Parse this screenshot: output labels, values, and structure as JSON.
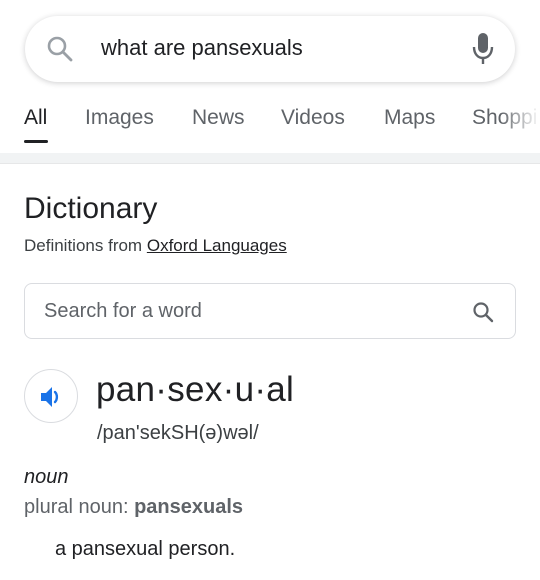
{
  "search": {
    "query": "what are pansexuals"
  },
  "tabs": [
    {
      "label": "All"
    },
    {
      "label": "Images"
    },
    {
      "label": "News"
    },
    {
      "label": "Videos"
    },
    {
      "label": "Maps"
    },
    {
      "label": "Shoppi"
    }
  ],
  "dictionary": {
    "title": "Dictionary",
    "source_prefix": "Definitions from",
    "source_link": "Oxford Languages",
    "word_search_placeholder": "Search for a word",
    "headword": "pan·sex·u·al",
    "phonetic": "/pan'sekSH(ə)wəl/",
    "part_of_speech": "noun",
    "plural_label": "plural noun:",
    "plural_value": "pansexuals",
    "definition": "a pansexual person."
  },
  "colors": {
    "accent_blue": "#1a73e8",
    "google_blue": "#4285f4",
    "mic_gray": "#5f6368"
  },
  "icons": {
    "search": "search-icon",
    "mic": "microphone-icon",
    "word_search": "search-icon",
    "audio": "speaker-icon"
  }
}
